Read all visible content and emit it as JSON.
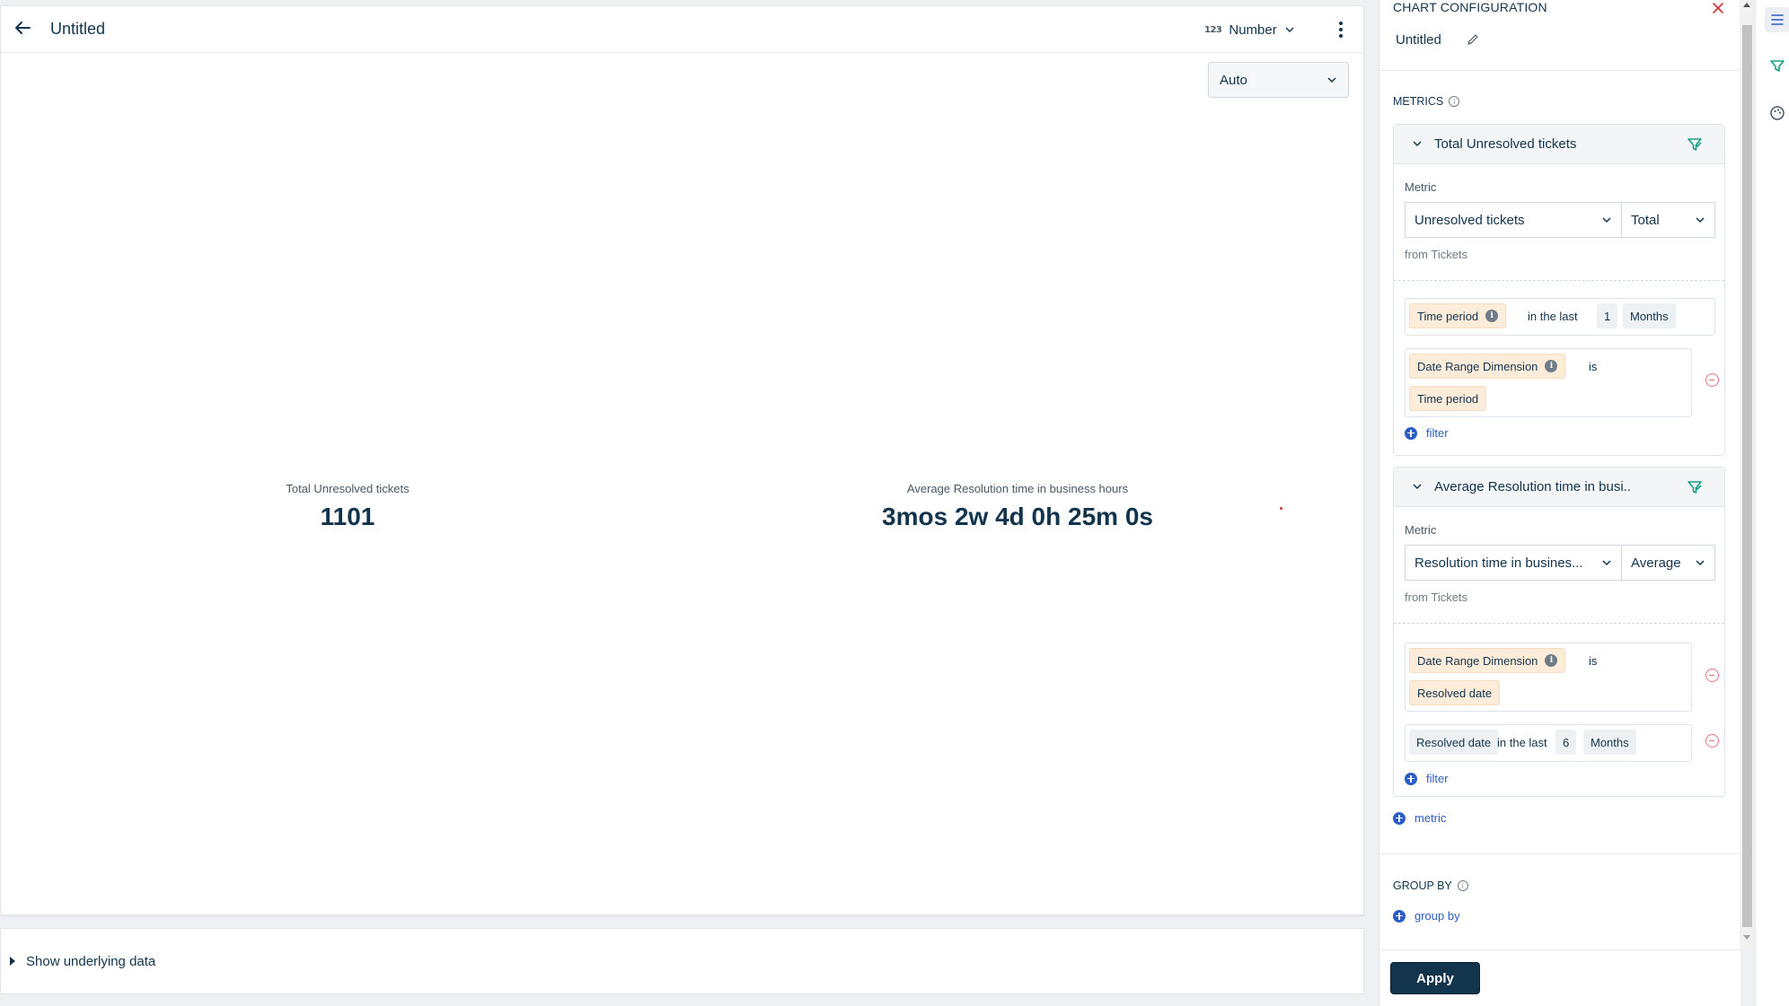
{
  "header": {
    "title": "Untitled",
    "chart_type_icon": "123",
    "chart_type_label": "Number"
  },
  "auto_select": {
    "value": "Auto"
  },
  "kpis": [
    {
      "title": "Total Unresolved tickets",
      "value": "1101"
    },
    {
      "title": "Average Resolution time in business hours",
      "value": "3mos 2w 4d 0h 25m 0s"
    }
  ],
  "underlying_data": {
    "label": "Show underlying data"
  },
  "panel": {
    "title": "CHART CONFIGURATION",
    "name": "Untitled",
    "metrics_label": "METRICS",
    "group_by_label": "GROUP BY",
    "add_metric": "metric",
    "add_group_by": "group by",
    "apply": "Apply",
    "metrics": [
      {
        "title": "Total Unresolved tickets",
        "metric_label": "Metric",
        "metric_value": "Unresolved tickets",
        "aggregation": "Total",
        "from": "from Tickets",
        "filters": {
          "time_period": {
            "field": "Time period",
            "op": "in the last",
            "count": "1",
            "unit": "Months"
          },
          "date_range": {
            "field": "Date Range Dimension",
            "op": "is",
            "value": "Time period"
          }
        },
        "add_filter": "filter"
      },
      {
        "title": "Average Resolution time in busi..",
        "metric_label": "Metric",
        "metric_value": "Resolution time in busines...",
        "aggregation": "Average",
        "from": "from Tickets",
        "filters": {
          "date_range": {
            "field": "Date Range Dimension",
            "op": "is",
            "value": "Resolved date"
          },
          "resolved": {
            "field": "Resolved date",
            "op": "in the last",
            "count": "6",
            "unit": "Months"
          }
        },
        "add_filter": "filter"
      }
    ]
  },
  "colors": {
    "primary_text": "#12344d",
    "accent_blue": "#2c5cc5",
    "chip_orange": "#fdecd9",
    "remove_red": "#e8727a",
    "filter_icon_green": "#16a085"
  }
}
